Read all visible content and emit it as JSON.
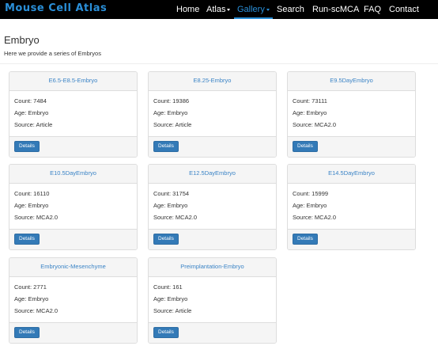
{
  "navbar": {
    "brand": "Mouse Cell Atlas",
    "items": [
      {
        "label": "Home"
      },
      {
        "label": "Atlas"
      },
      {
        "label": "Gallery"
      },
      {
        "label": "Search"
      },
      {
        "label": "Run-scMCA"
      },
      {
        "label": "FAQ"
      },
      {
        "label": "Contact"
      }
    ]
  },
  "page": {
    "title": "Embryo",
    "subtitle": "Here we provide a series of Embryos"
  },
  "cards": [
    {
      "title": "E6.5-E8.5-Embryo",
      "count": "Count: 7484",
      "age": "Age: Embryo",
      "source": "Source: Article",
      "button": "Details"
    },
    {
      "title": "E8.25-Embryo",
      "count": "Count: 19386",
      "age": "Age: Embryo",
      "source": "Source: Article",
      "button": "Details"
    },
    {
      "title": "E9.5DayEmbryo",
      "count": "Count: 73111",
      "age": "Age: Embryo",
      "source": "Source: MCA2.0",
      "button": "Details"
    },
    {
      "title": "E10.5DayEmbryo",
      "count": "Count: 16110",
      "age": "Age: Embryo",
      "source": "Source: MCA2.0",
      "button": "Details"
    },
    {
      "title": "E12.5DayEmbryo",
      "count": "Count: 31754",
      "age": "Age: Embryo",
      "source": "Source: MCA2.0",
      "button": "Details"
    },
    {
      "title": "E14.5DayEmbryo",
      "count": "Count: 15999",
      "age": "Age: Embryo",
      "source": "Source: MCA2.0",
      "button": "Details"
    },
    {
      "title": "Embryonic-Mesenchyme",
      "count": "Count: 2771",
      "age": "Age: Embryo",
      "source": "Source: MCA2.0",
      "button": "Details"
    },
    {
      "title": "Preimplantation-Embryo",
      "count": "Count: 161",
      "age": "Age: Embryo",
      "source": "Source: Article",
      "button": "Details"
    }
  ],
  "colors": {
    "navbar_bg": "#000000",
    "brand": "#2a8fd8",
    "link": "#3b84c6",
    "button": "#337ab7"
  }
}
